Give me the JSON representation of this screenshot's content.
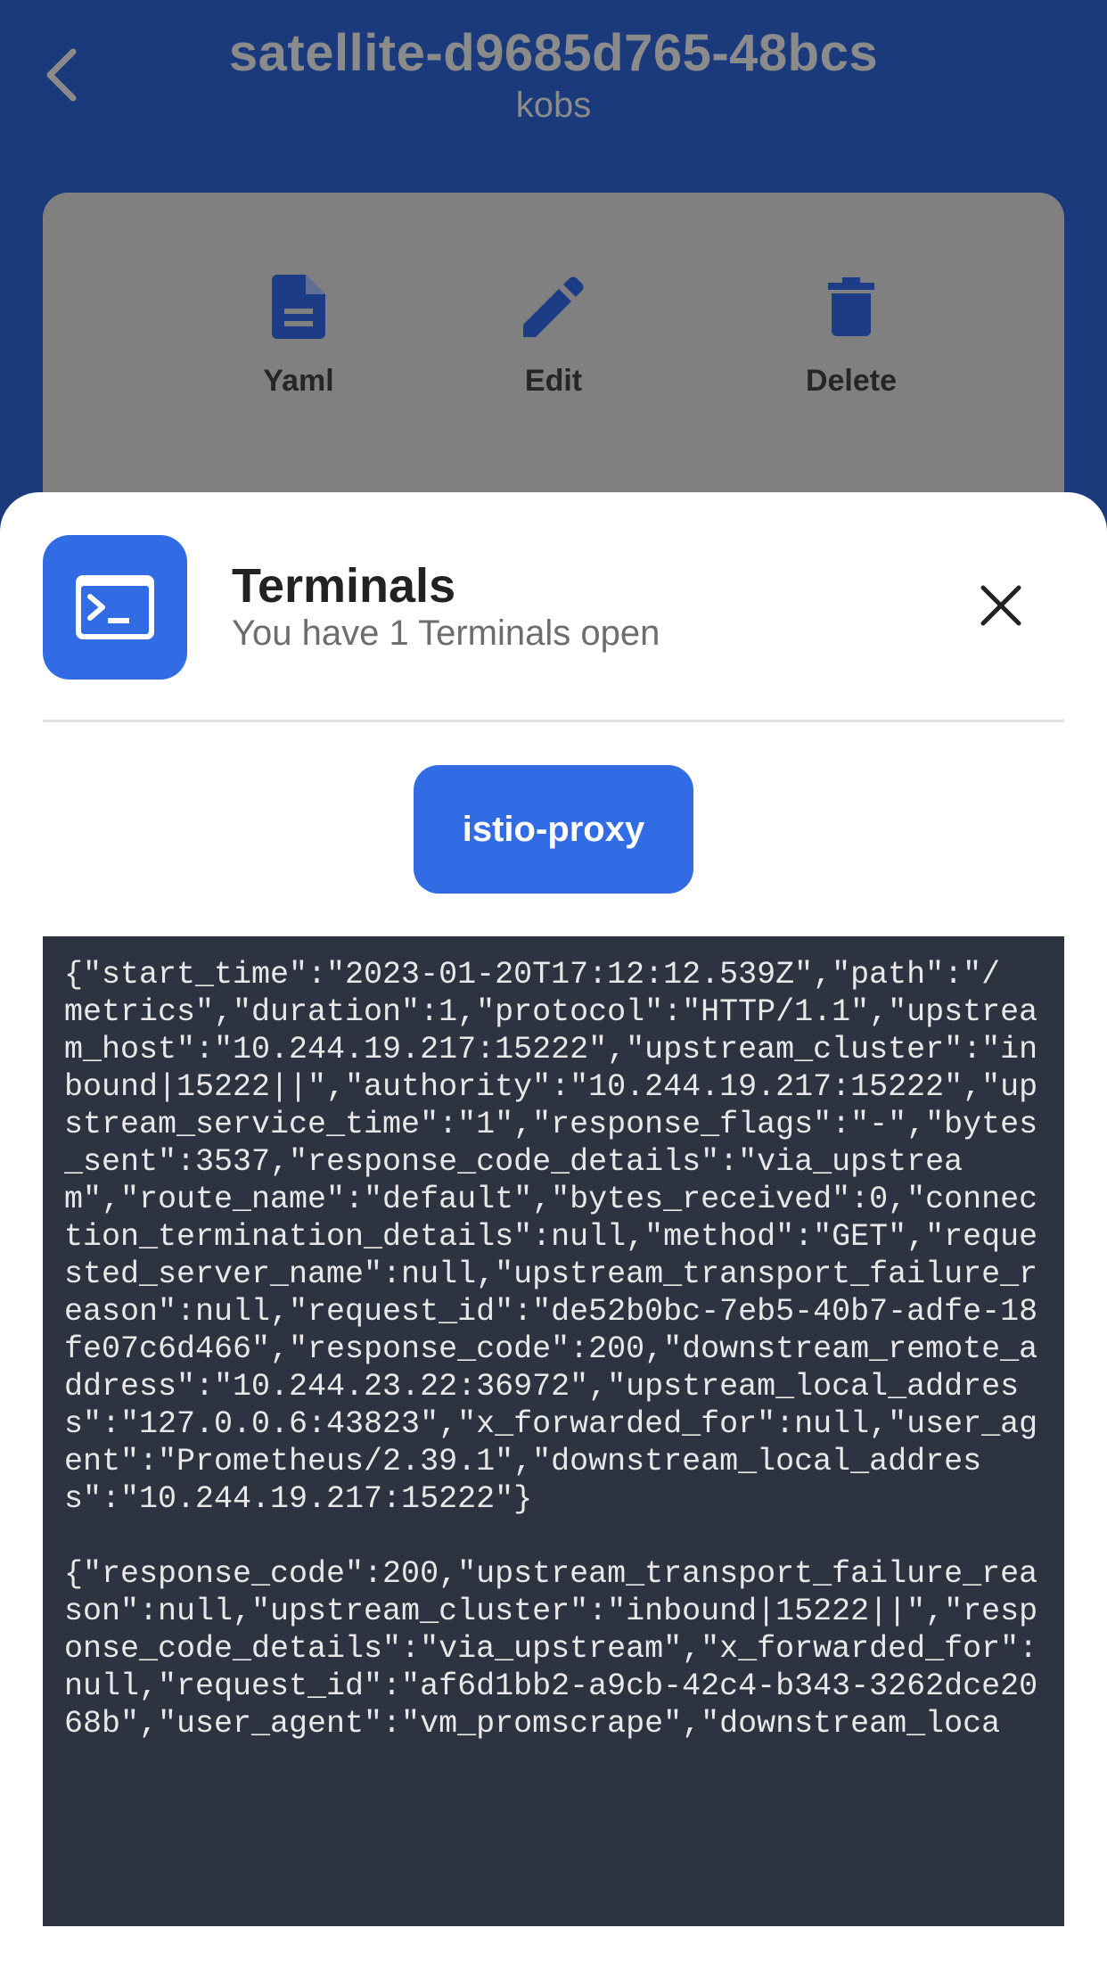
{
  "header": {
    "title": "satellite-d9685d765-48bcs",
    "subtitle": "kobs"
  },
  "actions": [
    {
      "label": "Yaml",
      "icon": "document-icon"
    },
    {
      "label": "Edit",
      "icon": "pencil-icon"
    },
    {
      "label": "Delete",
      "icon": "trash-icon"
    }
  ],
  "sheet": {
    "title": "Terminals",
    "subtitle": "You have 1 Terminals open",
    "container_chip": "istio-proxy"
  },
  "terminal": {
    "entries": [
      "{\"start_time\":\"2023-01-20T17:12:12.539Z\",\"path\":\"/\nmetrics\",\"duration\":1,\"protocol\":\"HTTP/1.1\",\"upstream_host\":\"10.244.19.217:15222\",\"upstream_cluster\":\"inbound|15222||\",\"authority\":\"10.244.19.217:15222\",\"upstream_service_time\":\"1\",\"response_flags\":\"-\",\"bytes_sent\":3537,\"response_code_details\":\"via_upstream\",\"route_name\":\"default\",\"bytes_received\":0,\"connection_termination_details\":null,\"method\":\"GET\",\"requested_server_name\":null,\"upstream_transport_failure_reason\":null,\"request_id\":\"de52b0bc-7eb5-40b7-adfe-18fe07c6d466\",\"response_code\":200,\"downstream_remote_address\":\"10.244.23.22:36972\",\"upstream_local_address\":\"127.0.0.6:43823\",\"x_forwarded_for\":null,\"user_agent\":\"Prometheus/2.39.1\",\"downstream_local_address\":\"10.244.19.217:15222\"}",
      "{\"response_code\":200,\"upstream_transport_failure_reason\":null,\"upstream_cluster\":\"inbound|15222||\",\"response_code_details\":\"via_upstream\",\"x_forwarded_for\":null,\"request_id\":\"af6d1bb2-a9cb-42c4-b343-3262dce2068b\",\"user_agent\":\"vm_promscrape\",\"downstream_loca"
    ]
  },
  "colors": {
    "header_bg": "#1b3a7c",
    "card_bg": "#808080",
    "accent": "#326ce5",
    "terminal_bg": "#2d3340",
    "terminal_text": "#e8e8e8"
  }
}
